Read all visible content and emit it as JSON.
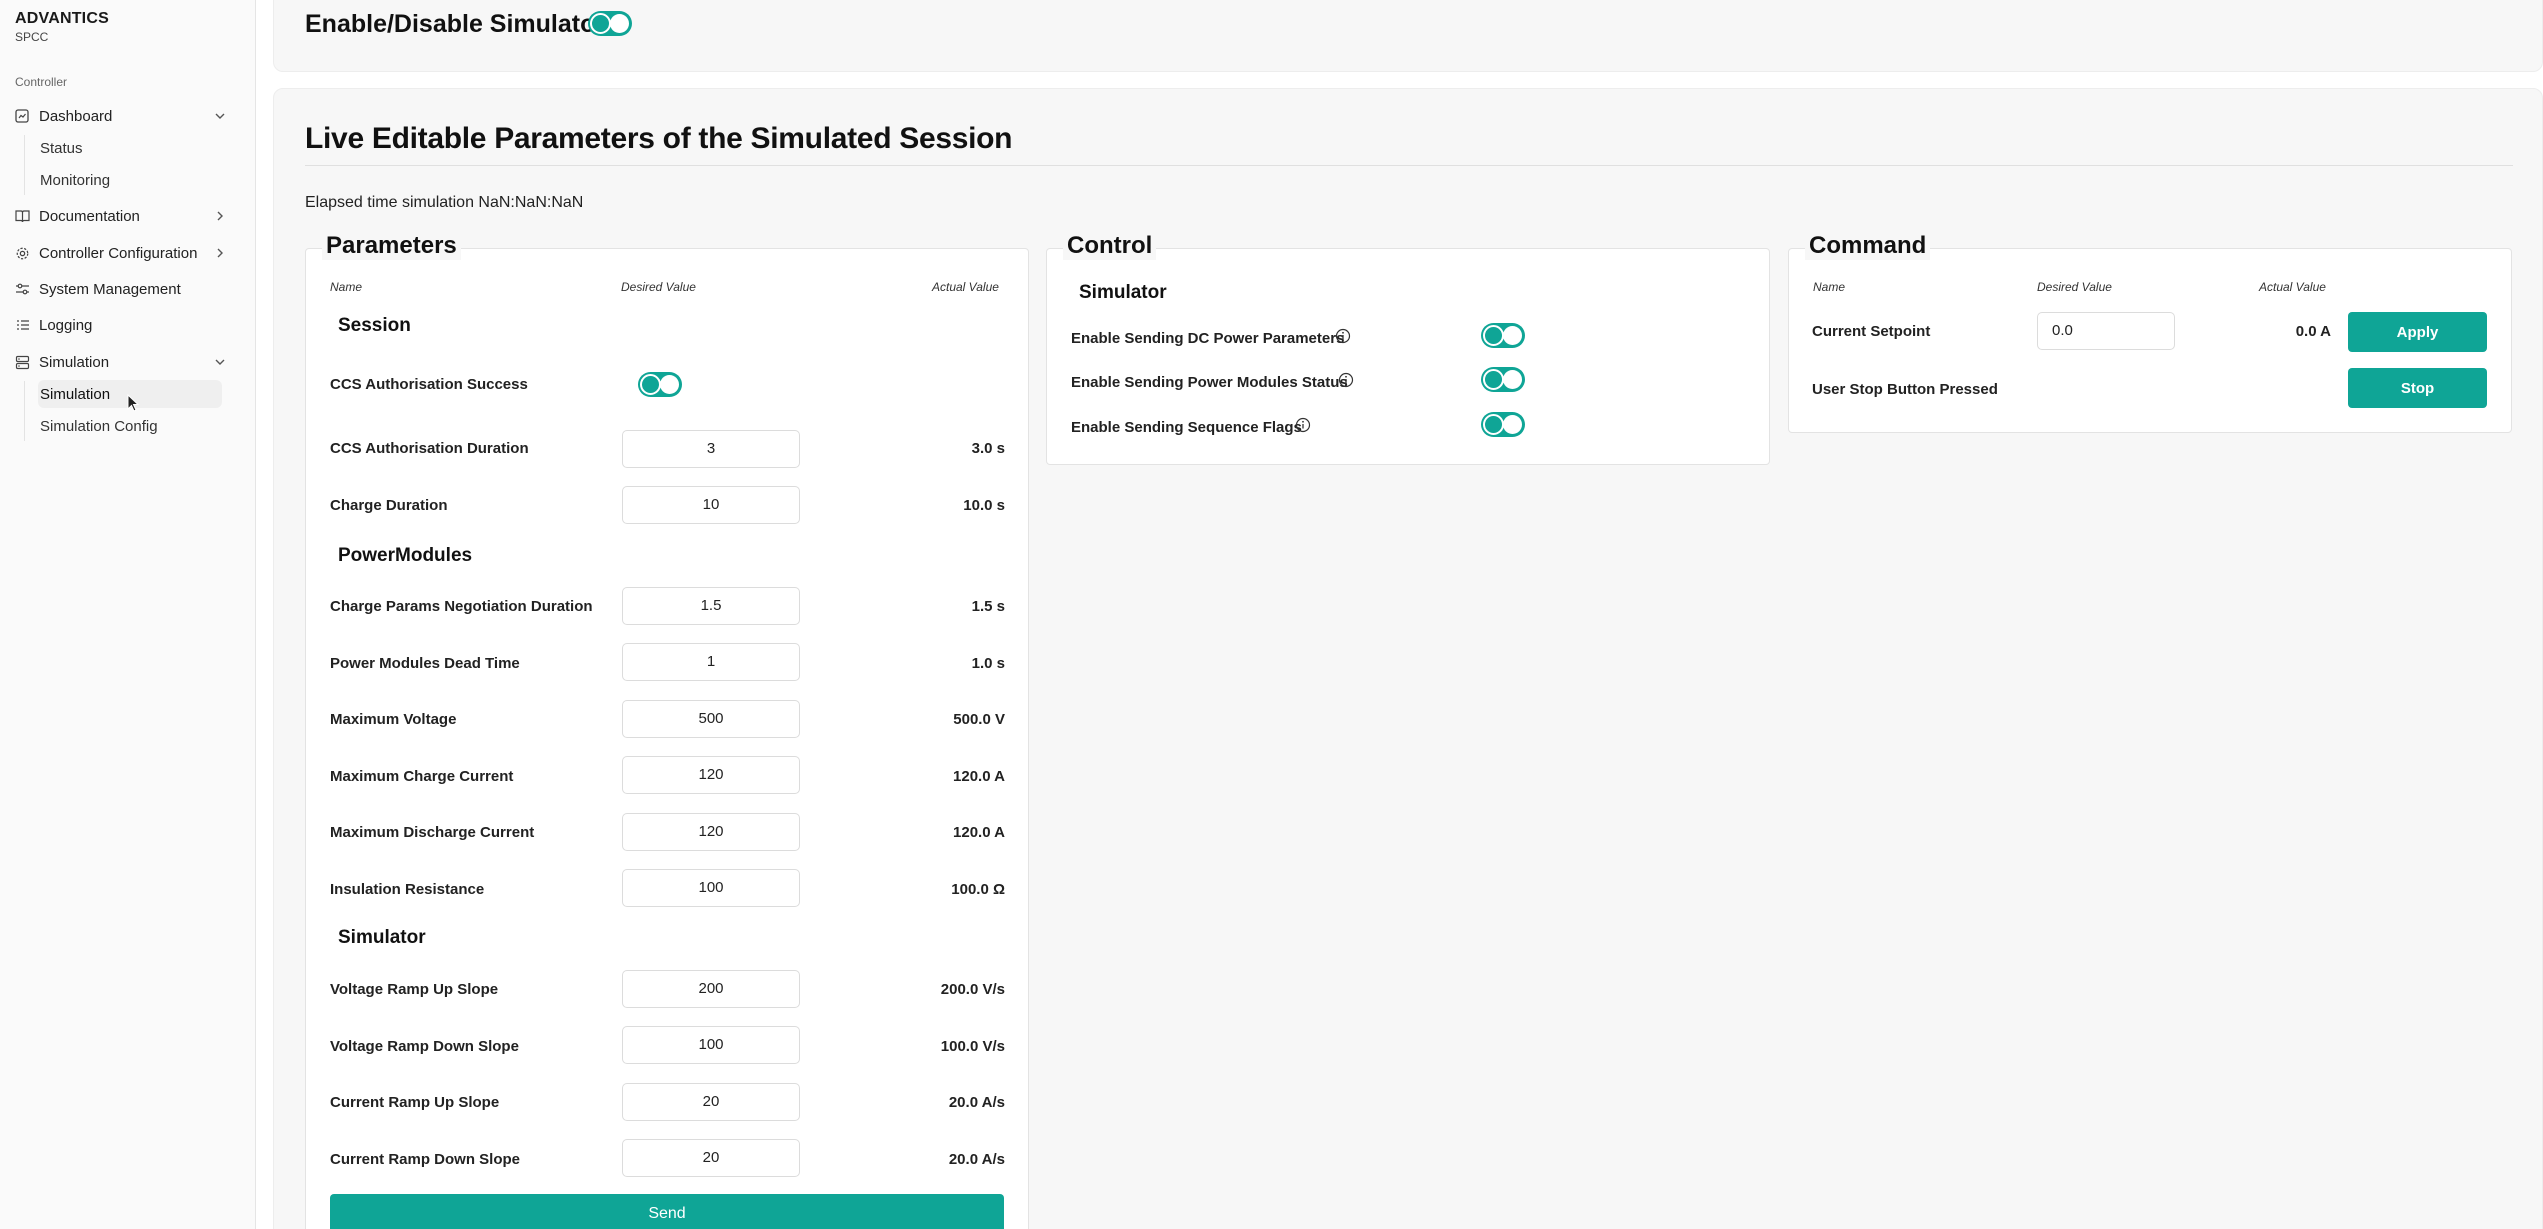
{
  "brand": {
    "title": "ADVANTICS",
    "subtitle": "SPCC"
  },
  "sidebar": {
    "group_label": "Controller",
    "items": [
      {
        "label": "Dashboard",
        "icon": "dashboard-icon",
        "chevron": "chevron-down-icon"
      },
      {
        "label": "Documentation",
        "icon": "book-icon",
        "chevron": "chevron-right-icon"
      },
      {
        "label": "Controller Configuration",
        "icon": "gear-icon",
        "chevron": "chevron-right-icon"
      },
      {
        "label": "System Management",
        "icon": "sliders-icon"
      },
      {
        "label": "Logging",
        "icon": "log-icon"
      },
      {
        "label": "Simulation",
        "icon": "database-icon",
        "chevron": "chevron-down-icon"
      }
    ],
    "dashboard_sub": [
      "Status",
      "Monitoring"
    ],
    "simulation_sub": [
      "Simulation",
      "Simulation Config"
    ],
    "active_sub": "Simulation"
  },
  "header": {
    "title": "Enable/Disable Simulator",
    "enabled": true
  },
  "section": {
    "title": "Live Editable Parameters of the Simulated Session",
    "elapsed": "Elapsed time simulation NaN:NaN:NaN"
  },
  "parameters": {
    "legend": "Parameters",
    "columns": {
      "name": "Name",
      "desired": "Desired Value",
      "actual": "Actual Value"
    },
    "session_heading": "Session",
    "ccs_success_label": "CCS Authorisation Success",
    "ccs_success_enabled": true,
    "session_rows": [
      {
        "label": "CCS Authorisation Duration",
        "desired": "3",
        "actual": "3.0 s"
      },
      {
        "label": "Charge Duration",
        "desired": "10",
        "actual": "10.0 s"
      }
    ],
    "power_heading": "PowerModules",
    "power_rows": [
      {
        "label": "Charge Params Negotiation Duration",
        "desired": "1.5",
        "actual": "1.5 s"
      },
      {
        "label": "Power Modules Dead Time",
        "desired": "1",
        "actual": "1.0 s"
      },
      {
        "label": "Maximum Voltage",
        "desired": "500",
        "actual": "500.0 V"
      },
      {
        "label": "Maximum Charge Current",
        "desired": "120",
        "actual": "120.0 A"
      },
      {
        "label": "Maximum Discharge Current",
        "desired": "120",
        "actual": "120.0 A"
      },
      {
        "label": "Insulation Resistance",
        "desired": "100",
        "actual": "100.0 Ω"
      }
    ],
    "simulator_heading": "Simulator",
    "simulator_rows": [
      {
        "label": "Voltage Ramp Up Slope",
        "desired": "200",
        "actual": "200.0 V/s"
      },
      {
        "label": "Voltage Ramp Down Slope",
        "desired": "100",
        "actual": "100.0 V/s"
      },
      {
        "label": "Current Ramp Up Slope",
        "desired": "20",
        "actual": "20.0 A/s"
      },
      {
        "label": "Current Ramp Down Slope",
        "desired": "20",
        "actual": "20.0 A/s"
      }
    ],
    "send_label": "Send"
  },
  "control": {
    "legend": "Control",
    "heading": "Simulator",
    "rows": [
      {
        "label": "Enable Sending DC Power Parameters",
        "enabled": true
      },
      {
        "label": "Enable Sending Power Modules Status",
        "enabled": true
      },
      {
        "label": "Enable Sending Sequence Flags",
        "enabled": true
      }
    ]
  },
  "command": {
    "legend": "Command",
    "columns": {
      "name": "Name",
      "desired": "Desired Value",
      "actual": "Actual Value"
    },
    "setpoint_label": "Current Setpoint",
    "setpoint_desired": "0.0",
    "setpoint_actual": "0.0 A",
    "apply_label": "Apply",
    "stop_row_label": "User Stop Button Pressed",
    "stop_label": "Stop"
  },
  "colors": {
    "accent": "#0fa596",
    "panel": "#f7f7f7",
    "border": "#e3e3e3"
  }
}
